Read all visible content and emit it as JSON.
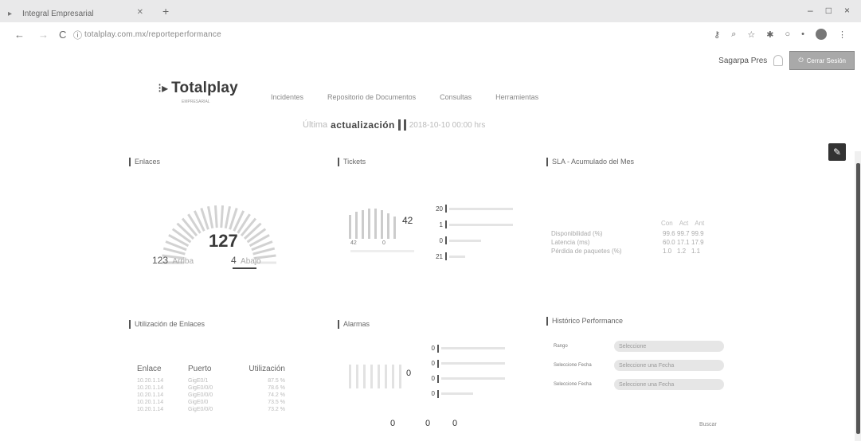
{
  "browser": {
    "tab_title": "Integral Empresarial",
    "url": "totalplay.com.mx/reporteperformance",
    "window_controls": [
      "–",
      "□",
      "×"
    ]
  },
  "header": {
    "user_name": "Sagarpa Pres",
    "logout_label": "Cerrar Sesión",
    "logo_name": "Totalplay",
    "logo_sub": "EMPRESARIAL"
  },
  "nav": {
    "items": [
      "Incidentes",
      "Repositorio de Documentos",
      "Consultas",
      "Herramientas"
    ]
  },
  "update": {
    "prefix": "Última",
    "word": "actualización",
    "date": "2018-10-10 00:00 hrs"
  },
  "enlaces": {
    "title": "Enlaces",
    "total": "127",
    "up_value": "123",
    "up_label": "Arriba",
    "down_value": "4",
    "down_label": "Abajo"
  },
  "tickets": {
    "title": "Tickets",
    "total": "42",
    "sub_left": "42",
    "sub_right": "0",
    "rows": [
      "20",
      "1",
      "0",
      "21"
    ]
  },
  "sla": {
    "title": "SLA - Acumulado del Mes",
    "headers": [
      "Con",
      "Act",
      "Ant"
    ],
    "rows": [
      {
        "label": "Disponibilidad (%)",
        "values": [
          "99.6",
          "99.7",
          "99.9"
        ]
      },
      {
        "label": "Latencia (ms)",
        "values": [
          "60.0",
          "17.1",
          "17.9"
        ]
      },
      {
        "label": "Pérdida de paquetes (%)",
        "values": [
          "1.0",
          "1.2",
          "1.1"
        ]
      }
    ]
  },
  "utilizacion": {
    "title": "Utilización de Enlaces",
    "headers": [
      "Enlace",
      "Puerto",
      "Utilización"
    ],
    "rows": [
      [
        "10.20.1.14",
        "GigE0/1",
        "87.5 %"
      ],
      [
        "10.20.1.14",
        "GigE0/0/0",
        "78.6 %"
      ],
      [
        "10.20.1.14",
        "GigE0/0/0",
        "74.2 %"
      ],
      [
        "10.20.1.14",
        "GigE0/0",
        "73.5 %"
      ],
      [
        "10.20.1.14",
        "GigE0/0/0",
        "73.2 %"
      ]
    ]
  },
  "alarmas": {
    "title": "Alarmas",
    "total": "0",
    "rows": [
      "0",
      "0",
      "0",
      "0"
    ],
    "bottom": [
      "0",
      "0",
      "0"
    ]
  },
  "historico": {
    "title": "Histórico Performance",
    "fields": [
      {
        "label": "Rango",
        "value": "Seleccione"
      },
      {
        "label": "Seleccione Fecha",
        "value": "Seleccione una Fecha"
      },
      {
        "label": "Seleccione Fecha",
        "value": "Seleccione una Fecha"
      }
    ],
    "button": "Buscar"
  }
}
